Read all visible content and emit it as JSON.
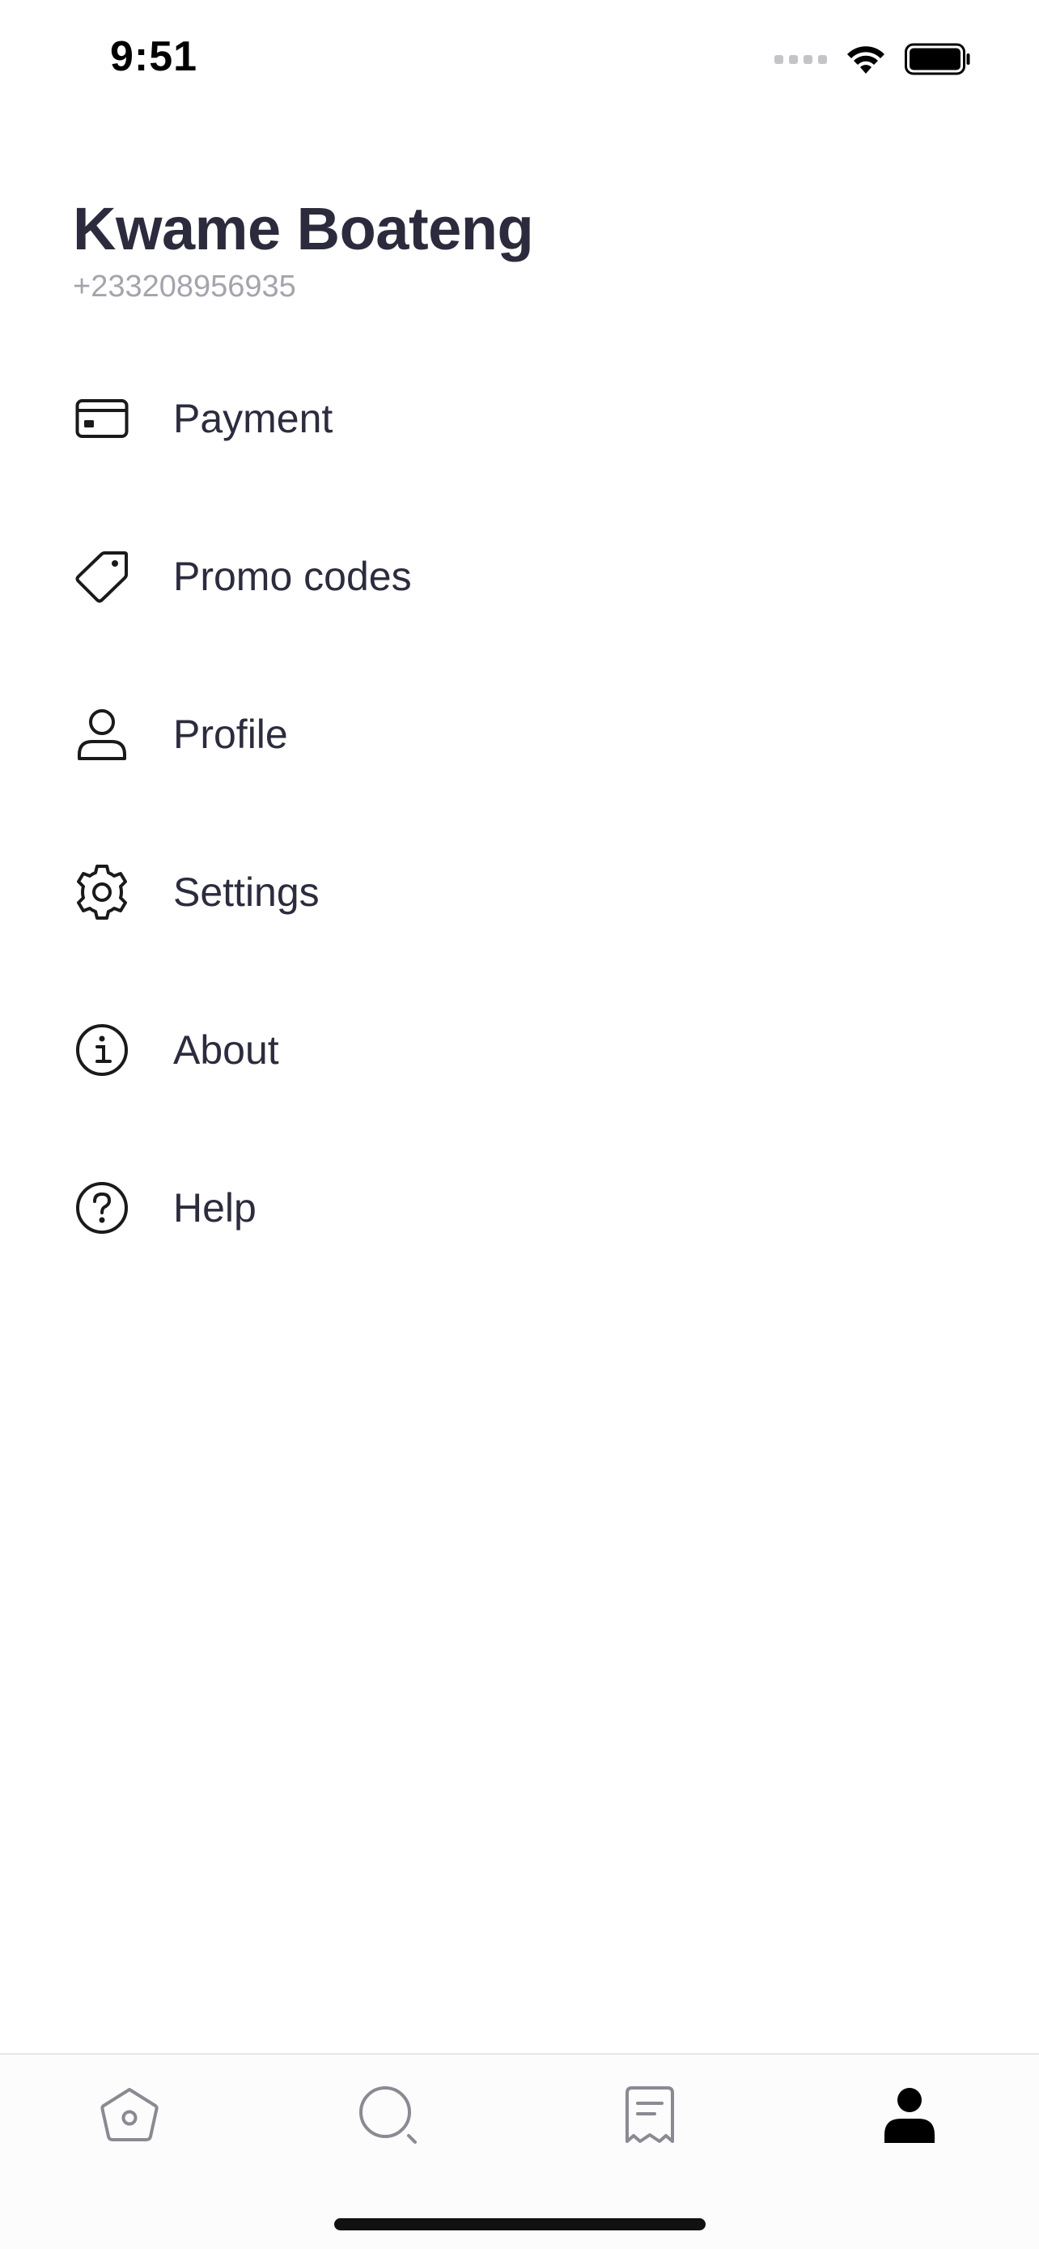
{
  "status_bar": {
    "time": "9:51"
  },
  "user": {
    "name": "Kwame Boateng",
    "phone": "+233208956935"
  },
  "menu": [
    {
      "label": "Payment",
      "icon": "credit-card-icon"
    },
    {
      "label": "Promo codes",
      "icon": "tag-icon"
    },
    {
      "label": "Profile",
      "icon": "person-icon"
    },
    {
      "label": "Settings",
      "icon": "gear-icon"
    },
    {
      "label": "About",
      "icon": "info-icon"
    },
    {
      "label": "Help",
      "icon": "question-icon"
    }
  ],
  "tab_bar": {
    "tabs": [
      {
        "icon": "home-icon",
        "active": false
      },
      {
        "icon": "search-icon",
        "active": false
      },
      {
        "icon": "receipt-icon",
        "active": false
      },
      {
        "icon": "account-icon",
        "active": true
      }
    ]
  },
  "colors": {
    "text_primary": "#2b2b3d",
    "text_secondary": "#a4a4ad",
    "tab_inactive": "#8a8a92",
    "tab_active": "#000000"
  }
}
